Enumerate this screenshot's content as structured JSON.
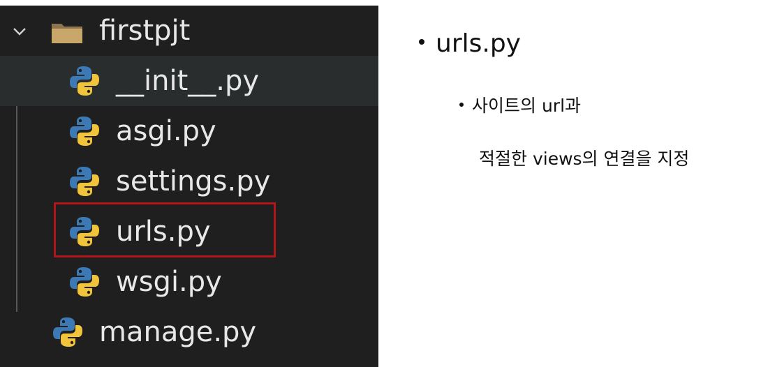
{
  "explorer": {
    "folder": {
      "name": "firstpjt",
      "expanded": true,
      "icon": "folder-icon",
      "children": [
        {
          "name": "__init__.py",
          "icon": "python-file-icon"
        },
        {
          "name": "asgi.py",
          "icon": "python-file-icon"
        },
        {
          "name": "settings.py",
          "icon": "python-file-icon"
        },
        {
          "name": "urls.py",
          "icon": "python-file-icon",
          "highlighted": true
        },
        {
          "name": "wsgi.py",
          "icon": "python-file-icon"
        }
      ]
    },
    "root_files": [
      {
        "name": "manage.py",
        "icon": "python-file-icon"
      }
    ]
  },
  "notes": {
    "title": "urls.py",
    "sub_line1": "사이트의 url과",
    "sub_line2": "적절한 views의 연결을 지정"
  },
  "colors": {
    "explorer_bg": "#1f1f1f",
    "highlight_border": "#b0161a",
    "python_blue": "#3d7ab5",
    "python_yellow": "#f2c43c",
    "folder": "#c9a76a"
  }
}
